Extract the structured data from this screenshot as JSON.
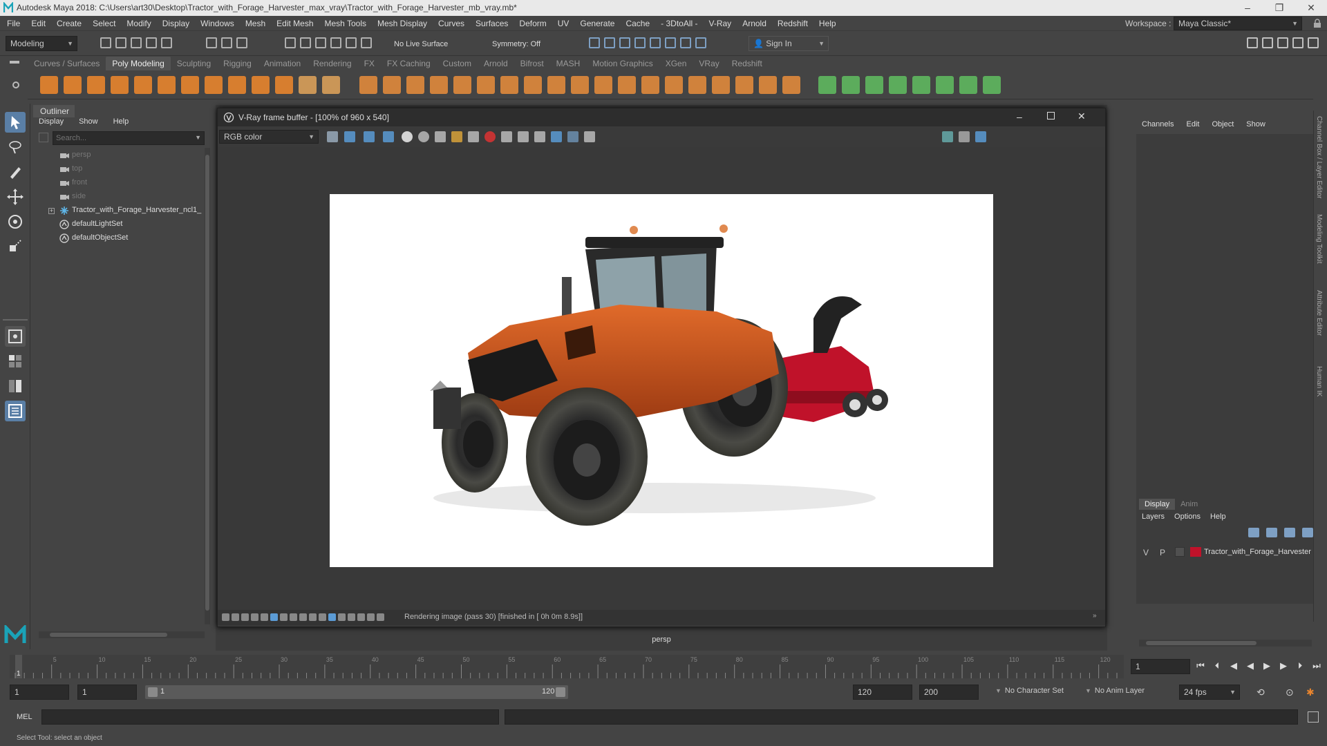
{
  "window": {
    "title": "Autodesk Maya 2018: C:\\Users\\art30\\Desktop\\Tractor_with_Forage_Harvester_max_vray\\Tractor_with_Forage_Harvester_mb_vray.mb*",
    "minimize": "–",
    "restore": "❐",
    "close": "✕"
  },
  "menubar": {
    "items": [
      "File",
      "Edit",
      "Create",
      "Select",
      "Modify",
      "Display",
      "Windows",
      "Mesh",
      "Edit Mesh",
      "Mesh Tools",
      "Mesh Display",
      "Curves",
      "Surfaces",
      "Deform",
      "UV",
      "Generate",
      "Cache",
      "- 3DtoAll -",
      "V-Ray",
      "Arnold",
      "Redshift",
      "Help"
    ],
    "workspace_label": "Workspace :",
    "workspace_value": "Maya Classic*"
  },
  "statusline": {
    "mode": "Modeling",
    "live_surface": "No Live Surface",
    "symmetry": "Symmetry: Off",
    "sign_in": "Sign In"
  },
  "shelf": {
    "tabs": [
      "Curves / Surfaces",
      "Poly Modeling",
      "Sculpting",
      "Rigging",
      "Animation",
      "Rendering",
      "FX",
      "FX Caching",
      "Custom",
      "Arnold",
      "Bifrost",
      "MASH",
      "Motion Graphics",
      "XGen",
      "VRay",
      "Redshift"
    ],
    "active_tab": "Poly Modeling"
  },
  "outliner": {
    "title": "Outliner",
    "menu": [
      "Display",
      "Show",
      "Help"
    ],
    "search_placeholder": "Search...",
    "items": [
      {
        "label": "persp",
        "icon": "camera-icon",
        "dim": true
      },
      {
        "label": "top",
        "icon": "camera-icon",
        "dim": true
      },
      {
        "label": "front",
        "icon": "camera-icon",
        "dim": true
      },
      {
        "label": "side",
        "icon": "camera-icon",
        "dim": true
      },
      {
        "label": "Tractor_with_Forage_Harvester_ncl1_",
        "icon": "group-icon",
        "dim": false
      },
      {
        "label": "defaultLightSet",
        "icon": "set-icon",
        "dim": false
      },
      {
        "label": "defaultObjectSet",
        "icon": "set-icon",
        "dim": false
      }
    ]
  },
  "vfb": {
    "title": "V-Ray frame buffer - [100% of 960 x 540]",
    "channel": "RGB color",
    "status": "Rendering image (pass 30) [finished in [ 0h  0m  8.9s]]"
  },
  "viewport": {
    "camera_label": "persp"
  },
  "channelbox": {
    "menu": [
      "Channels",
      "Edit",
      "Object",
      "Show"
    ],
    "layer_tabs": [
      "Display",
      "Anim"
    ],
    "layer_menu": [
      "Layers",
      "Options",
      "Help"
    ],
    "layer_v": "V",
    "layer_p": "P",
    "layer_name": "Tractor_with_Forage_Harvester",
    "layer_color": "#c0122a"
  },
  "side_tabs": [
    "Channel Box / Layer Editor",
    "Modeling Toolkit",
    "Attribute Editor",
    "Human IK"
  ],
  "timeline": {
    "ticks": [
      "5",
      "10",
      "15",
      "20",
      "25",
      "30",
      "35",
      "40",
      "45",
      "50",
      "55",
      "60",
      "65",
      "70",
      "75",
      "80",
      "85",
      "90",
      "95",
      "100",
      "105",
      "110",
      "115",
      "120"
    ],
    "current_frame": "1"
  },
  "range": {
    "start": "1",
    "playback_start": "1",
    "slider_start": "1",
    "slider_end": "120",
    "playback_end": "120",
    "end": "200",
    "character_set": "No Character Set",
    "anim_layer": "No Anim Layer",
    "fps": "24 fps"
  },
  "cmdline": {
    "label": "MEL"
  },
  "helpline": {
    "text": "Select Tool: select an object"
  },
  "colors": {
    "accent_blue": "#5b9bd5",
    "shelf_orange": "#e8852e",
    "tractor_orange": "#d2561e"
  }
}
